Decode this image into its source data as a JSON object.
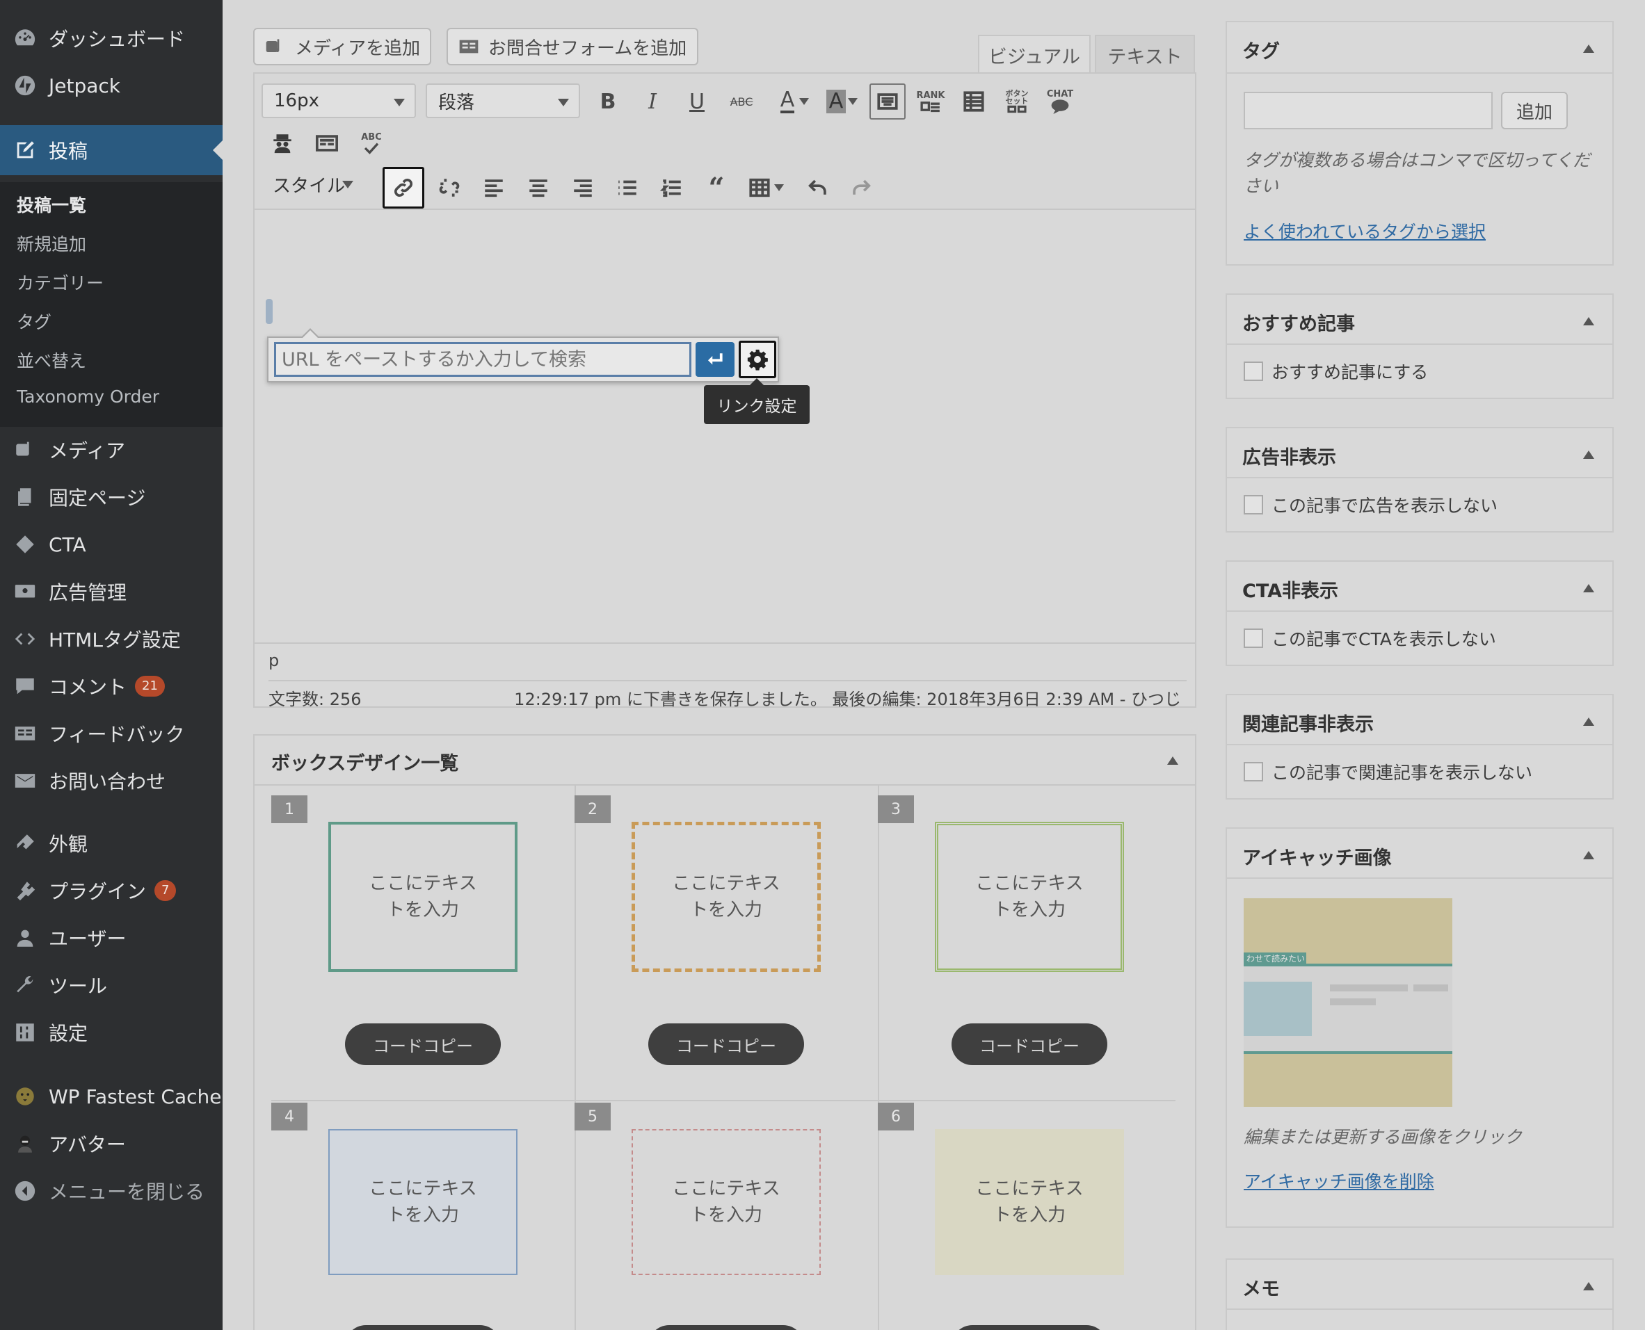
{
  "sidebar": {
    "top_items": [
      {
        "label": "ダッシュボード",
        "icon": "dashboard-icon"
      },
      {
        "label": "Jetpack",
        "icon": "jetpack-icon"
      }
    ],
    "active_item": {
      "label": "投稿",
      "icon": "posts-icon"
    },
    "submenu": [
      "投稿一覧",
      "新規追加",
      "カテゴリー",
      "タグ",
      "並べ替え",
      "Taxonomy Order"
    ],
    "items": [
      {
        "label": "メディア",
        "icon": "media-icon"
      },
      {
        "label": "固定ページ",
        "icon": "pages-icon"
      },
      {
        "label": "CTA",
        "icon": "cta-icon"
      },
      {
        "label": "広告管理",
        "icon": "ads-icon"
      },
      {
        "label": "HTMLタグ設定",
        "icon": "code-icon"
      },
      {
        "label": "コメント",
        "icon": "comment-icon",
        "badge": "21"
      },
      {
        "label": "フィードバック",
        "icon": "feedback-icon"
      },
      {
        "label": "お問い合わせ",
        "icon": "mail-icon"
      },
      {
        "label": "外観",
        "icon": "appearance-icon"
      },
      {
        "label": "プラグイン",
        "icon": "plugin-icon",
        "badge": "7"
      },
      {
        "label": "ユーザー",
        "icon": "user-icon"
      },
      {
        "label": "ツール",
        "icon": "tools-icon"
      },
      {
        "label": "設定",
        "icon": "settings-icon"
      },
      {
        "label": "WP Fastest Cache",
        "icon": "cheetah-icon"
      },
      {
        "label": "アバター",
        "icon": "avatar-icon"
      },
      {
        "label": "メニューを閉じる",
        "icon": "collapse-icon"
      }
    ]
  },
  "editor": {
    "add_media": "メディアを追加",
    "add_form": "お問合せフォームを追加",
    "tab_visual": "ビジュアル",
    "tab_text": "テキスト",
    "font_size": "16px",
    "format": "段落",
    "styles": "スタイル",
    "rank_label": "RANK",
    "button_set_label": "ボタン\nセット",
    "chat_label": "CHAT",
    "abc_label": "ABC",
    "url_placeholder": "URL をペーストするか入力して検索",
    "link_settings_tooltip": "リンク設定",
    "path": "p",
    "word_count": "文字数: 256",
    "autosave": "12:29:17 pm に下書きを保存しました。 最後の編集: 2018年3月6日 2:39 AM - ひつじ"
  },
  "box_designs": {
    "title": "ボックスデザイン一覧",
    "copy_label": "コードコピー",
    "items": [
      {
        "num": "1",
        "text": "ここにテキス\nトを入力"
      },
      {
        "num": "2",
        "text": "ここにテキス\nトを入力"
      },
      {
        "num": "3",
        "text": "ここにテキス\nトを入力"
      },
      {
        "num": "4",
        "text": "ここにテキス\nトを入力"
      },
      {
        "num": "5",
        "text": "ここにテキス\nトを入力"
      },
      {
        "num": "6",
        "text": "ここにテキス\nトを入力"
      }
    ]
  },
  "meta": {
    "tags": {
      "title": "タグ",
      "add_button": "追加",
      "hint": "タグが複数ある場合はコンマで区切ってください",
      "choose_link": "よく使われているタグから選択"
    },
    "featured": {
      "title": "おすすめ記事",
      "checkbox": "おすすめ記事にする"
    },
    "hide_ads": {
      "title": "広告非表示",
      "checkbox": "この記事で広告を表示しない"
    },
    "hide_cta": {
      "title": "CTA非表示",
      "checkbox": "この記事でCTAを表示しない"
    },
    "hide_related": {
      "title": "関連記事非表示",
      "checkbox": "この記事で関連記事を表示しない"
    },
    "eyecatch": {
      "title": "アイキャッチ画像",
      "hint": "編集または更新する画像をクリック",
      "remove_link": "アイキャッチ画像を削除",
      "thumb_label": "わせて読みたい"
    },
    "memo": {
      "title": "メモ"
    }
  },
  "colors": {
    "sidebar_bg": "#2d2f31",
    "active_bg": "#2a5a80",
    "badge": "#b5492a",
    "link": "#2f6aa3",
    "box1_border": "#5f9a88",
    "box2_border": "#c99b58",
    "box3_border": "#9ab86e",
    "box4_border": "#7f9cbf",
    "box5_border": "#c48b8b",
    "box6_bg": "#d9d7c3"
  }
}
